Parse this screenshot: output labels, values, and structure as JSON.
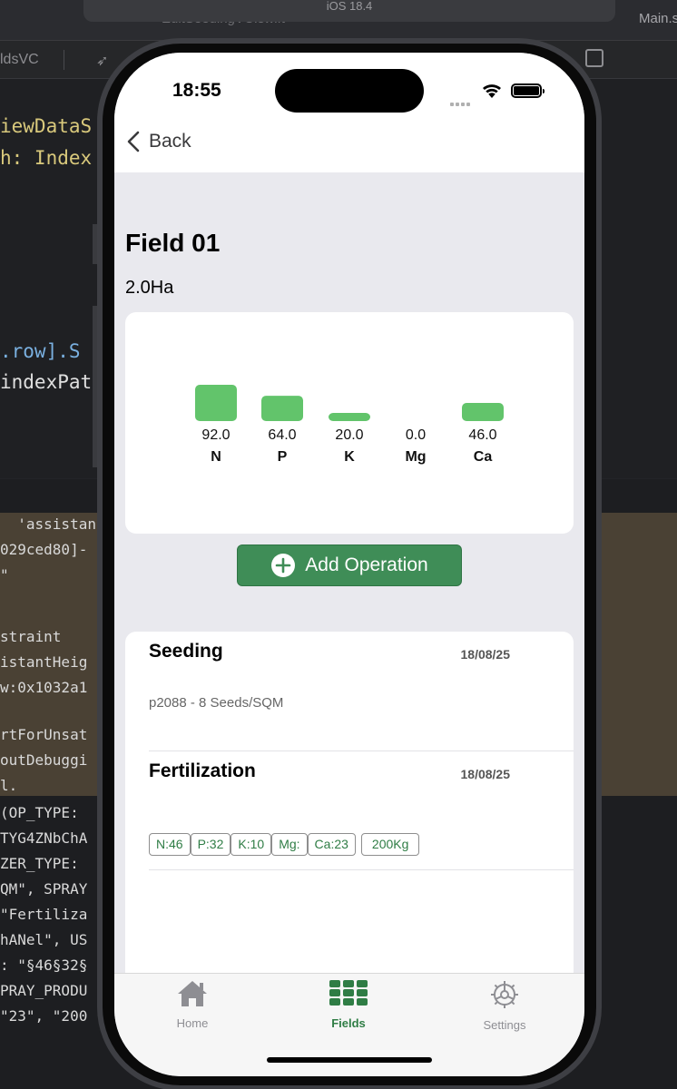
{
  "xcode": {
    "titlebar_text": "iOS 18.4",
    "file_tab": "EditSeedingVC.swift",
    "main_tab": "Main.s",
    "jump_crumb": "ldsVC",
    "code_lines": [
      {
        "text": "iewDataS",
        "color": "#d9c97c"
      },
      {
        "text": "h: Index",
        "color": "#d9c97c"
      },
      {
        "text": ".row].S",
        "color": "#7ab0e0"
      },
      {
        "text": "indexPat",
        "color": "#e0e0e0"
      }
    ],
    "console_lines": [
      "  'assistan",
      "029ced80]-",
      "\"",
      "straint",
      "istantHeig",
      "w:0x1032a1",
      "rtForUnsat",
      "outDebuggi",
      "l.",
      "(OP_TYPE:",
      "TYG4ZNbChA",
      "ZER_TYPE:",
      "QM\", SPRAY",
      "\"Fertiliza",
      "hANel\", US",
      ": \"§46§32§",
      "PRAY_PRODU",
      "",
      "\"23\", \"200"
    ]
  },
  "status": {
    "time": "18:55"
  },
  "nav": {
    "back_label": "Back"
  },
  "field": {
    "name": "Field 01",
    "area": "2.0Ha"
  },
  "chart_data": {
    "type": "bar",
    "categories": [
      "N",
      "P",
      "K",
      "Mg",
      "Ca"
    ],
    "values": [
      92.0,
      64.0,
      20.0,
      0.0,
      46.0
    ],
    "value_labels": [
      "92.0",
      "64.0",
      "20.0",
      "0.0",
      "46.0"
    ],
    "bar_color": "#62c46b",
    "ylim": [
      0,
      92
    ]
  },
  "actions": {
    "add_operation": "Add Operation"
  },
  "operations": [
    {
      "name": "Seeding",
      "date": "18/08/25",
      "description": "p2088 -  8 Seeds/SQM"
    },
    {
      "name": "Fertilization",
      "date": "18/08/25",
      "tags": [
        "N:46",
        "P:32",
        "K:10",
        "Mg:",
        "Ca:23"
      ],
      "amount": "200Kg"
    }
  ],
  "tabbar": {
    "items": [
      {
        "label": "Home",
        "icon": "house-icon",
        "active": false
      },
      {
        "label": "Fields",
        "icon": "grid-icon",
        "active": true
      },
      {
        "label": "Settings",
        "icon": "gear-icon",
        "active": false
      }
    ],
    "active_color": "#2f7d45",
    "inactive_color": "#8e8e93"
  }
}
